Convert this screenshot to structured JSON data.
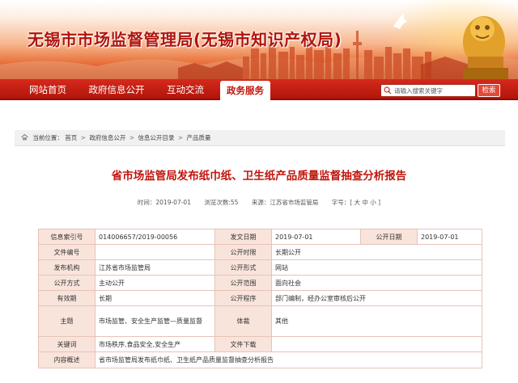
{
  "header": {
    "site_title": "无锡市市场监督管理局(无锡市知识产权局)"
  },
  "nav": {
    "items": [
      {
        "label": "网站首页",
        "active": false
      },
      {
        "label": "政府信息公开",
        "active": false
      },
      {
        "label": "互动交流",
        "active": false
      },
      {
        "label": "政务服务",
        "active": true
      }
    ],
    "search_placeholder": "请输入搜索关键字",
    "search_button": "检索"
  },
  "breadcrumb": {
    "prefix": "当前位置：",
    "items": [
      "首页",
      "政府信息公开",
      "信息公开目录",
      "产品质量"
    ],
    "separator": ">"
  },
  "article": {
    "title": "省市场监管局发布纸巾纸、卫生纸产品质量监督抽查分析报告",
    "meta": {
      "time": "时间：2019-07-01",
      "views": "浏览次数:55",
      "source": "来源：江苏省市场监管局",
      "font_size": "字号：[ 大 中 小 ]"
    }
  },
  "table": {
    "index_label": "信息索引号",
    "index_value": "014006657/2019-00056",
    "doc_date_label": "发文日期",
    "doc_date_value": "2019-07-01",
    "pub_date_label": "公开日期",
    "pub_date_value": "2019-07-01",
    "doc_no_label": "文件编号",
    "doc_no_value": "",
    "pub_period_label": "公开时限",
    "pub_period_value": "长期公开",
    "issuer_label": "发布机构",
    "issuer_value": "江苏省市场监管局",
    "pub_form_label": "公开形式",
    "pub_form_value": "网站",
    "pub_method_label": "公开方式",
    "pub_method_value": "主动公开",
    "pub_scope_label": "公开范围",
    "pub_scope_value": "面向社会",
    "validity_label": "有效期",
    "validity_value": "长期",
    "pub_proc_label": "公开程序",
    "pub_proc_value": "部门编制，经办公室审核后公开",
    "topic_label": "主题",
    "topic_value": "市场监管、安全生产监管—质量监督",
    "genre_label": "体裁",
    "genre_value": "其他",
    "keywords_label": "关键词",
    "keywords_value": "市场秩序,食品安全,安全生产",
    "download_label": "文件下载",
    "download_value": "",
    "summary_label": "内容概述",
    "summary_value": "省市场监管局发布纸巾纸、卫生纸产品质量监督抽查分析报告"
  },
  "colors": {
    "brand_red": "#c0150d",
    "nav_red": "#c81f13",
    "label_bg": "#f9e4dc",
    "border": "#e7c3b8"
  }
}
